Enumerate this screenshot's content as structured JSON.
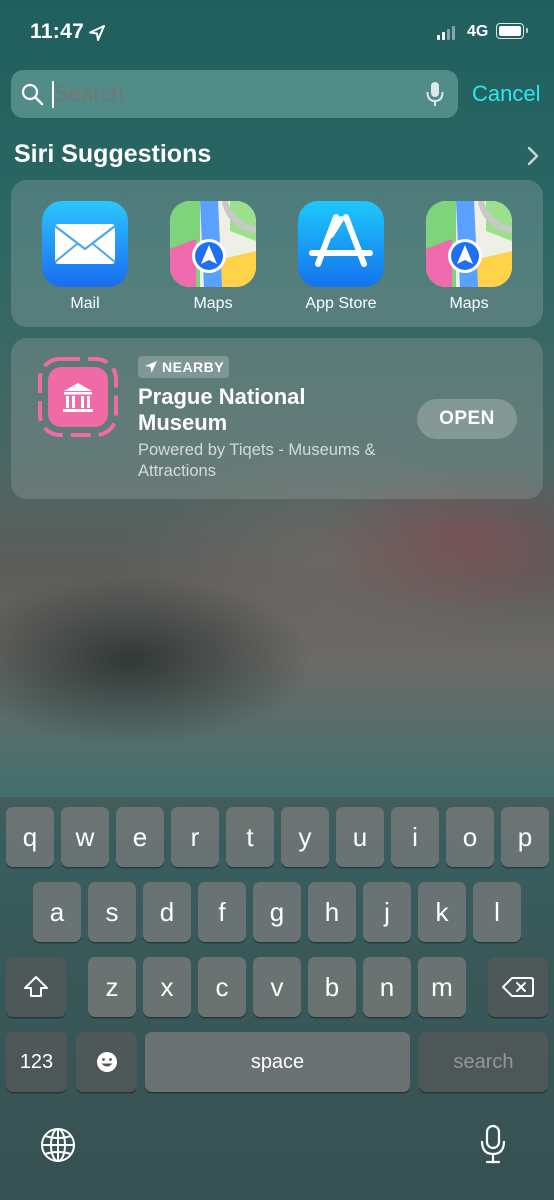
{
  "status_bar": {
    "time": "11:47",
    "network": "4G",
    "battery_level": 0.85,
    "signal_bars": 4
  },
  "search": {
    "placeholder": "Search",
    "cancel_label": "Cancel"
  },
  "siri_suggestions": {
    "title": "Siri Suggestions",
    "apps": [
      {
        "name": "Mail",
        "icon": "mail-icon"
      },
      {
        "name": "Maps",
        "icon": "maps-icon"
      },
      {
        "name": "App Store",
        "icon": "app-store-icon"
      },
      {
        "name": "Maps",
        "icon": "maps-icon"
      }
    ]
  },
  "nearby": {
    "badge": "NEARBY",
    "title": "Prague National Museum",
    "subtitle": "Powered by Tiqets - Museums & Attractions",
    "open_label": "OPEN",
    "icon_color": "#f06aa6"
  },
  "keyboard": {
    "row1": [
      "q",
      "w",
      "e",
      "r",
      "t",
      "y",
      "u",
      "i",
      "o",
      "p"
    ],
    "row2": [
      "a",
      "s",
      "d",
      "f",
      "g",
      "h",
      "j",
      "k",
      "l"
    ],
    "row3": [
      "z",
      "x",
      "c",
      "v",
      "b",
      "n",
      "m"
    ],
    "numbers_label": "123",
    "space_label": "space",
    "return_label": "search"
  },
  "colors": {
    "accent": "#2ee6f0"
  }
}
